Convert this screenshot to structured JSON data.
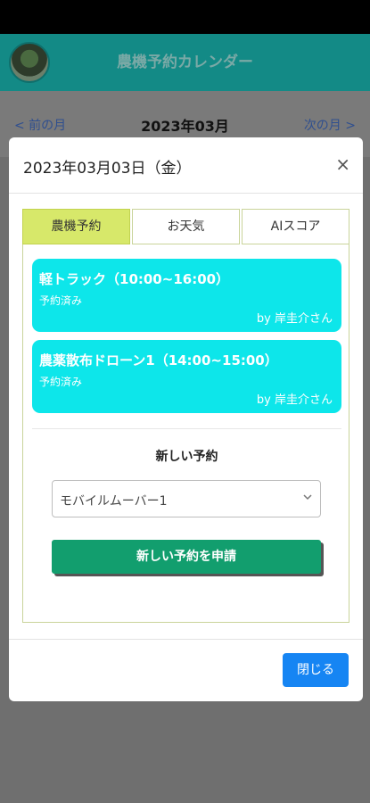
{
  "app": {
    "title": "農機予約カレンダー"
  },
  "nav": {
    "prev": "< 前の月",
    "current": "2023年03月",
    "next": "次の月 >"
  },
  "modal": {
    "title": "2023年03月03日（金）",
    "close_icon": "×",
    "tabs": [
      {
        "label": "農機予約",
        "active": true
      },
      {
        "label": "お天気",
        "active": false
      },
      {
        "label": "AIスコア",
        "active": false
      }
    ],
    "reservations": [
      {
        "title": "軽トラック（10:00~16:00）",
        "status": "予約済み",
        "by": "by 岸圭介さん"
      },
      {
        "title": "農薬散布ドローン1（14:00~15:00）",
        "status": "予約済み",
        "by": "by 岸圭介さん"
      }
    ],
    "new_reservation": {
      "label": "新しい予約",
      "selected": "モバイルムーバー1",
      "submit": "新しい予約を申請"
    },
    "close_button": "閉じる"
  },
  "colors": {
    "appbar": "#138a86",
    "tab_active": "#d7e86a",
    "card": "#0de6ea",
    "submit": "#129e6e",
    "close": "#1685f3"
  }
}
